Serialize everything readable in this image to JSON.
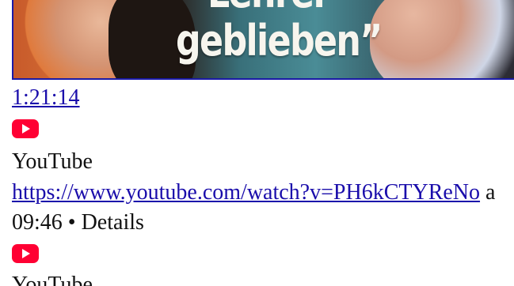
{
  "results": [
    {
      "thumbnail": {
        "headline_top": "Lehrer",
        "headline": "geblieben”"
      },
      "duration": "1:21:14",
      "source_icon": "youtube-icon",
      "source": "YouTube",
      "url": "https://www.youtube.com/watch?v=PH6kCTYReNo",
      "url_suffix": "a"
    },
    {
      "meta": "09:46 • Details",
      "source_icon": "youtube-icon",
      "source": "YouTube"
    }
  ],
  "colors": {
    "link": "#1a0dab",
    "youtube_red": "#ff0033",
    "thumbnail_border": "#1a1aa6"
  }
}
